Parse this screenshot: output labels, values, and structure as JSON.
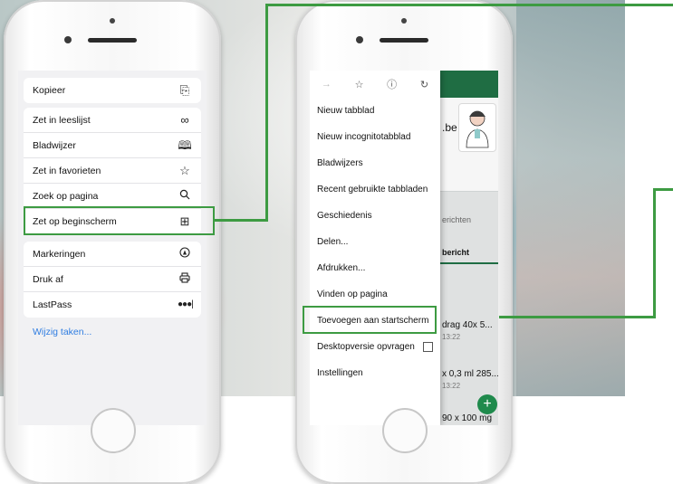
{
  "ios_share_sheet": {
    "copy_group": [
      {
        "label": "Kopieer",
        "icon": "copy-icon"
      }
    ],
    "actions_group": [
      {
        "label": "Zet in leeslijst",
        "icon": "glasses-icon"
      },
      {
        "label": "Bladwijzer",
        "icon": "book-icon"
      },
      {
        "label": "Zet in favorieten",
        "icon": "star-icon"
      },
      {
        "label": "Zoek op pagina",
        "icon": "search-icon"
      },
      {
        "label": "Zet op beginscherm",
        "icon": "add-square-icon"
      }
    ],
    "extras_group": [
      {
        "label": "Markeringen",
        "icon": "marker-icon"
      },
      {
        "label": "Druk af",
        "icon": "printer-icon"
      },
      {
        "label": "LastPass",
        "icon": "lastpass-icon"
      }
    ],
    "edit_actions": "Wijzig taken..."
  },
  "android_menu": {
    "top_icons": [
      "forward-icon",
      "star-icon",
      "info-icon",
      "refresh-icon"
    ],
    "items": [
      {
        "label": "Nieuw tabblad"
      },
      {
        "label": "Nieuw incognitotabblad"
      },
      {
        "label": "Bladwijzers"
      },
      {
        "label": "Recent gebruikte tabbladen"
      },
      {
        "label": "Geschiedenis"
      },
      {
        "label": "Delen..."
      },
      {
        "label": "Afdrukken..."
      },
      {
        "label": "Vinden op pagina"
      },
      {
        "label": "Toevoegen aan startscherm"
      },
      {
        "label": "Desktopversie opvragen"
      },
      {
        "label": "Instellingen"
      }
    ]
  },
  "android_app": {
    "brand_suffix": ".be",
    "messages_tab": "erichten",
    "message_tab": "bericht",
    "product_1_name": "drag 40x 5...",
    "product_1_time": "13:22",
    "product_2_name": "x 0,3 ml 285...",
    "product_2_time": "13:22",
    "product_3_name": "90 x 100 mg"
  },
  "colors": {
    "highlight": "#3d9b42",
    "android_primary": "#1f6d43",
    "ios_link": "#2f7de1"
  }
}
